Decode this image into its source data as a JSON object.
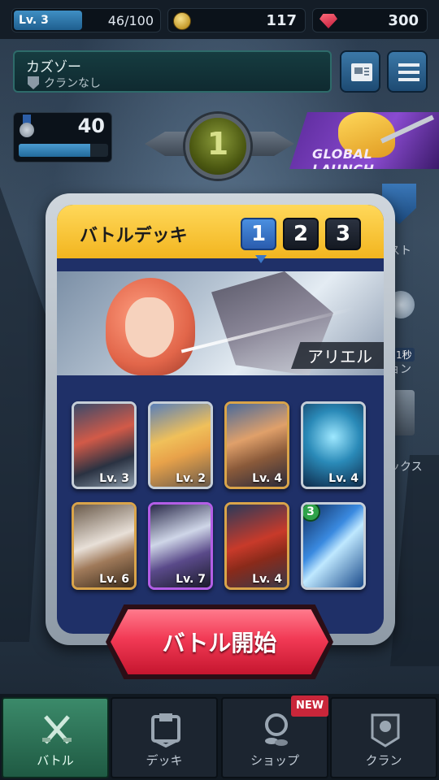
{
  "top_bar": {
    "level_label": "Lv. 3",
    "xp": "46/100",
    "xp_progress": 0.46,
    "coins": "117",
    "gems": "300"
  },
  "player": {
    "name": "カズゾー",
    "clan": "クランなし"
  },
  "trophies": {
    "count": "40",
    "progress": 0.8
  },
  "arena": {
    "number": "1"
  },
  "banner": {
    "text": "GLOBAL LAUNCH"
  },
  "deck": {
    "title": "バトルデッキ",
    "tabs": [
      "1",
      "2",
      "3"
    ],
    "active_tab": "1",
    "hero_name": "アリエル",
    "cards": [
      {
        "level": "Lv. 3",
        "frame": "silver",
        "cost": ""
      },
      {
        "level": "Lv. 2",
        "frame": "silver",
        "cost": ""
      },
      {
        "level": "Lv. 4",
        "frame": "gold",
        "cost": ""
      },
      {
        "level": "Lv. 4",
        "frame": "silver",
        "cost": ""
      },
      {
        "level": "Lv. 6",
        "frame": "gold",
        "cost": ""
      },
      {
        "level": "Lv. 7",
        "frame": "purple",
        "cost": ""
      },
      {
        "level": "Lv. 4",
        "frame": "gold",
        "cost": ""
      },
      {
        "level": "",
        "frame": "silver",
        "cost": "3"
      }
    ]
  },
  "start_button": {
    "label": "バトル開始"
  },
  "side": {
    "item1_text": "スト",
    "timer_badge": "1秒",
    "item2_text": "ョン",
    "item3_text": "ックス"
  },
  "bottom_nav": {
    "items": [
      {
        "label": "バトル",
        "icon": "crossed-swords-icon"
      },
      {
        "label": "デッキ",
        "icon": "deck-icon"
      },
      {
        "label": "ショップ",
        "icon": "shop-icon"
      },
      {
        "label": "クラン",
        "icon": "clan-banner-icon"
      }
    ],
    "new_badge": "NEW"
  },
  "colors": {
    "deck_header": "#f2b51f",
    "start_button": "#f23a55",
    "active_nav": "#3b8a6a",
    "active_tab": "#4a8fe0"
  }
}
